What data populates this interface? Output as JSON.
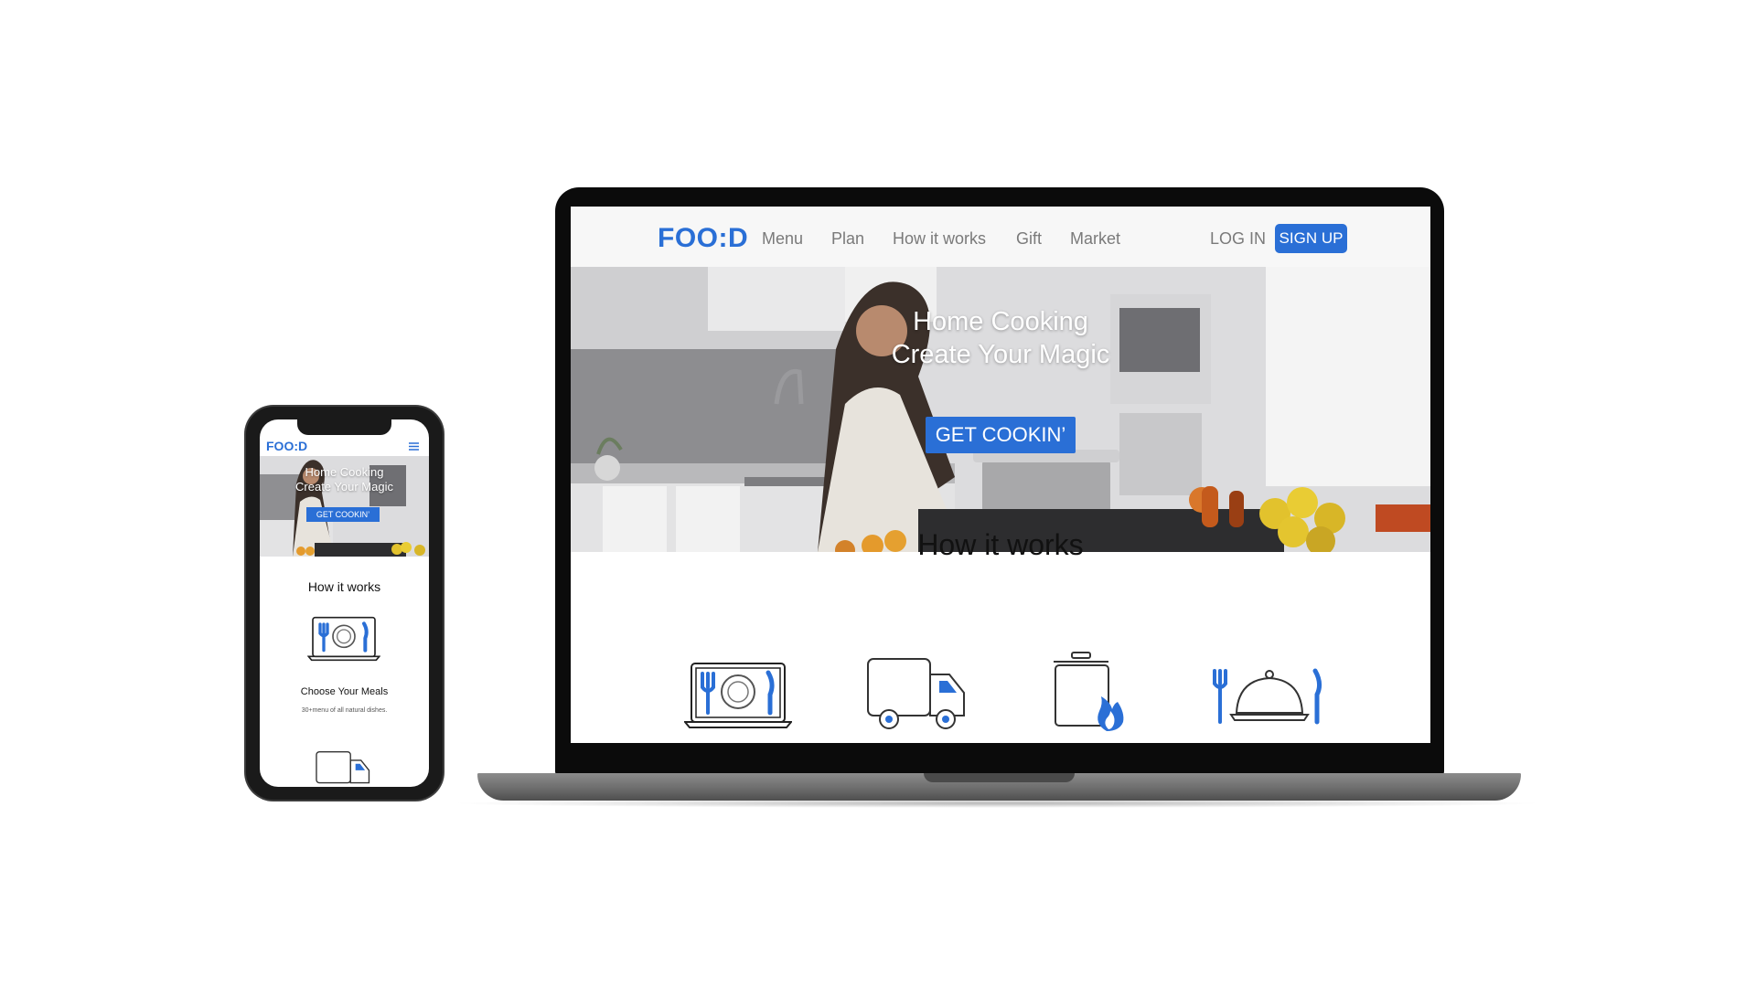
{
  "colors": {
    "brand": "#2a6fd6",
    "nav_text": "#7a7a7a",
    "hero_text": "#ffffff"
  },
  "desktop": {
    "logo": "FOO:D",
    "nav_items": [
      "Menu",
      "Plan",
      "How it works",
      "Gift",
      "Market"
    ],
    "login": "LOG IN",
    "signup": "SIGN UP",
    "hero": {
      "line1": "Home Cooking",
      "line2": "Create Your Magic",
      "cta": "GET COOKIN’"
    },
    "how_title": "How it works",
    "icons": [
      "laptop-plate-icon",
      "delivery-truck-icon",
      "cooking-pot-flame-icon",
      "serving-cloche-icon"
    ]
  },
  "mobile": {
    "logo": "FOO:D",
    "menu_icon": "hamburger-icon",
    "hero": {
      "line1": "Home Cooking",
      "line2": "Create Your Magic",
      "cta": "GET COOKIN’"
    },
    "how_title": "How it works",
    "step1_title": "Choose Your Meals",
    "step1_desc": "30+menu of all natural dishes."
  }
}
